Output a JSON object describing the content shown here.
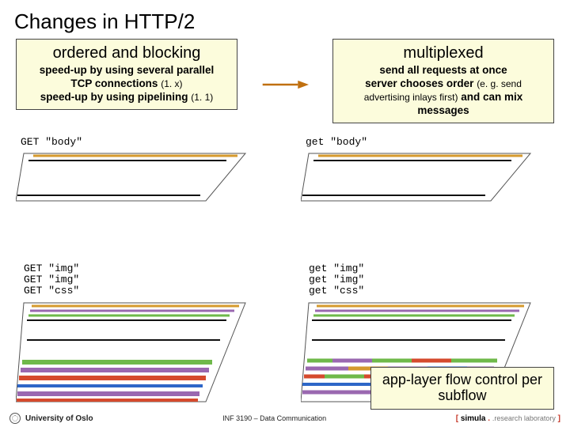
{
  "domain": "Diagram",
  "title": "Changes in HTTP/2",
  "left": {
    "title": "ordered and blocking",
    "line1a": "speed-up by using several parallel",
    "line1b": "TCP connections",
    "line1c": "(1. x)",
    "line2a": "speed-up by using pipelining",
    "line2b": "(1. 1)"
  },
  "right": {
    "title": "multiplexed",
    "line1": "send all requests at once",
    "line2a": "server chooses order",
    "line2b": "(e. g. send advertising inlays first)",
    "line2c": "and can mix messages"
  },
  "labels": {
    "left_top": "GET \"body\"",
    "left_mid": "GET \"img\"\nGET \"img\"\nGET \"css\"",
    "right_top": "get \"body\"",
    "right_mid": "get \"img\"\nget \"img\"\nget \"css\""
  },
  "callout": {
    "line1": "app-layer flow control per",
    "line2": "subflow"
  },
  "footer": {
    "left": "University of Oslo",
    "center": "INF 3190 – Data Communication",
    "right_brand": "simula",
    "right_tag": ".research laboratory"
  },
  "chart_data": {
    "type": "diagram",
    "description": "Two side-by-side timing diagrams comparing HTTP/1.x ordered/blocking request flow vs HTTP/2 multiplexed flow. Top parallelograms show a single GET 'body' request/response; lower parallelograms show three parallel GETs (img, img, css) drawn as colored horizontal stripes across time. The right (multiplexed) column interleaves the colored stripes to indicate mixed message ordering.",
    "left_sequence": {
      "phase1": [
        "GET body"
      ],
      "phase2": [
        "GET img",
        "GET img",
        "GET css"
      ]
    },
    "right_sequence": {
      "phase1": [
        "get body"
      ],
      "phase2": [
        "get img",
        "get img",
        "get css"
      ],
      "interleaved": true
    },
    "stripe_colors": [
      "#d59a2d",
      "#9a68b0",
      "#6fb94a",
      "#d54a2d",
      "#2d66c8"
    ]
  }
}
